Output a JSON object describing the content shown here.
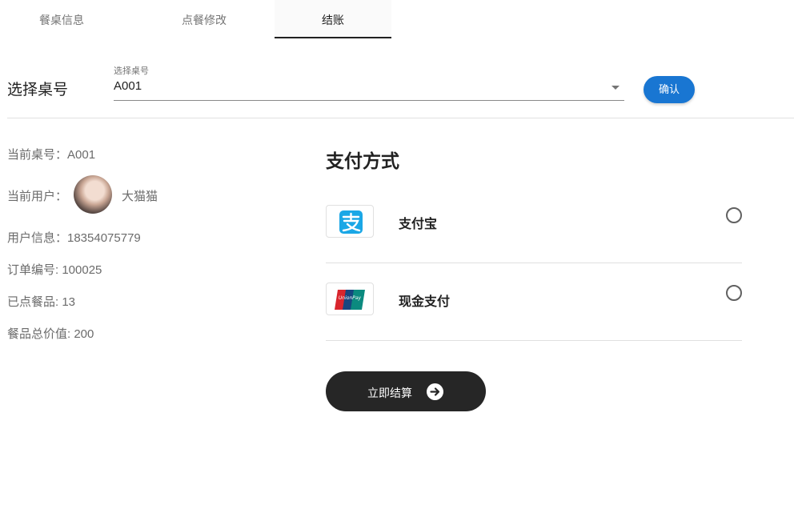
{
  "tabs": [
    {
      "label": "餐桌信息"
    },
    {
      "label": "点餐修改"
    },
    {
      "label": "结账"
    }
  ],
  "table_select": {
    "title": "选择桌号",
    "field_label": "选择桌号",
    "value": "A001",
    "confirm_label": "确认"
  },
  "info": {
    "table_line": "当前桌号：A001",
    "user_label": "当前用户：",
    "user_name": "大猫猫",
    "phone_line": "用户信息：18354075779",
    "order_line": "订单编号: 100025",
    "items_line": "已点餐品: 13",
    "total_line": "餐品总价值: 200"
  },
  "payment": {
    "title": "支付方式",
    "methods": [
      {
        "name": "支付宝",
        "icon": "alipay-logo-icon",
        "selected": false
      },
      {
        "name": "现金支付",
        "icon": "unionpay-logo-icon",
        "logo_text": "UnionPay",
        "selected": false
      }
    ],
    "checkout_label": "立即结算",
    "checkout_icon": "arrow-right-circle-icon"
  },
  "colors": {
    "primary": "#1976d2",
    "alipay": "#1aa7e6",
    "dark_button": "#262626"
  }
}
